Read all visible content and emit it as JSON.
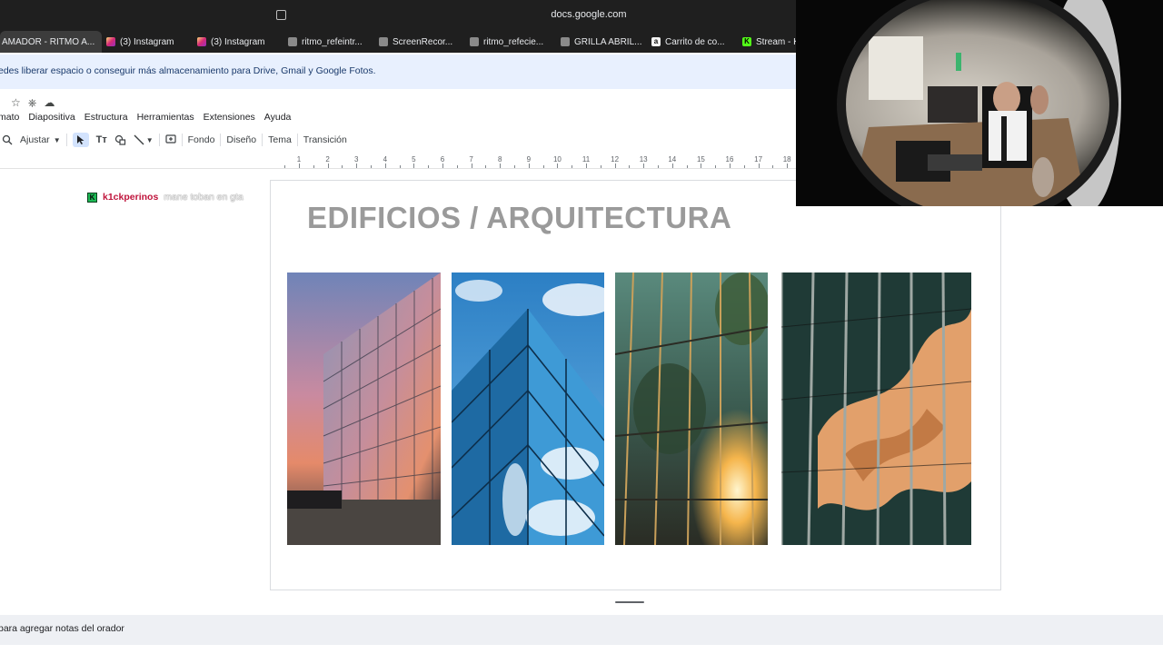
{
  "browser": {
    "url": "docs.google.com",
    "tabs": [
      {
        "label": "AMADOR - RITMO A...",
        "icon": "docs-icon",
        "active": true
      },
      {
        "label": "(3) Instagram",
        "icon": "instagram-icon"
      },
      {
        "label": "(3) Instagram",
        "icon": "instagram-icon"
      },
      {
        "label": "ritmo_refeintr...",
        "icon": "slides-icon"
      },
      {
        "label": "ScreenRecor...",
        "icon": "slides-icon"
      },
      {
        "label": "ritmo_refecie...",
        "icon": "slides-icon"
      },
      {
        "label": "GRILLA ABRIL...",
        "icon": "slides-icon"
      },
      {
        "label": "Carrito de co...",
        "icon": "amazon-icon"
      },
      {
        "label": "Stream - Ki",
        "icon": "kick-icon"
      }
    ]
  },
  "banner": {
    "text": "edes liberar espacio o conseguir más almacenamiento para Drive, Gmail y Google Fotos."
  },
  "menu": [
    "mato",
    "Diapositiva",
    "Estructura",
    "Herramientas",
    "Extensiones",
    "Ayuda"
  ],
  "toolbar": {
    "zoom_label": "Ajustar",
    "background_label": "Fondo",
    "design_label": "Diseño",
    "theme_label": "Tema",
    "transition_label": "Transición"
  },
  "ruler_numbers": [
    "1",
    "2",
    "3",
    "4",
    "5",
    "6",
    "7",
    "8",
    "9",
    "10",
    "11",
    "12",
    "13",
    "14",
    "15",
    "16",
    "17",
    "18"
  ],
  "chat": {
    "badge": "K",
    "user": "k1ckperinos",
    "message": "mane toban en gta"
  },
  "slide": {
    "title": "EDIFICIOS / ARQUITECTURA",
    "photos": [
      "glass-building-sunset-photo",
      "glass-building-sky-photo",
      "glass-building-trees-photo",
      "glass-facade-reflection-photo"
    ]
  },
  "notes": {
    "placeholder": "para agregar notas del orador"
  },
  "colors": {
    "accent_blue": "#1a73e8",
    "chat_user": "#c0143c",
    "kick_green": "#53fc18",
    "title_gray": "#9a9a9a"
  }
}
